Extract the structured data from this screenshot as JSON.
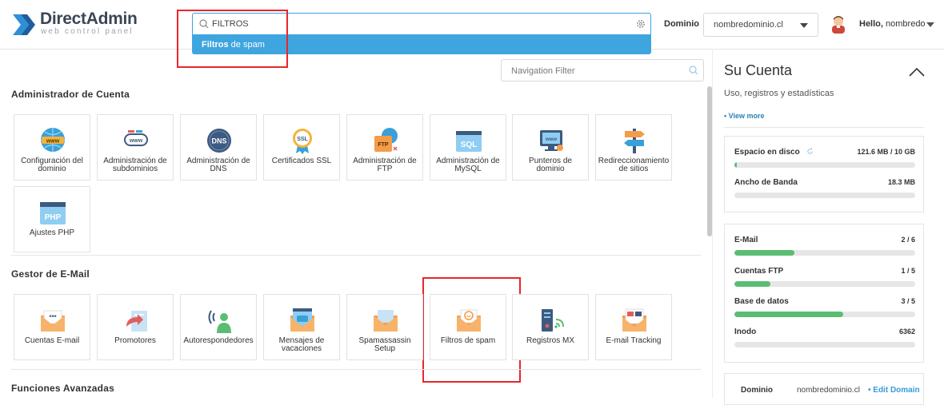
{
  "header": {
    "logo_title": "DirectAdmin",
    "logo_subtitle": "web control panel",
    "search_value": "FILTROS",
    "suggestion_bold": "Filtros",
    "suggestion_rest": " de spam",
    "domain_label": "Dominio",
    "domain_selected": "nombredominio.cl",
    "hello_prefix": "Hello, ",
    "username": "nombredo"
  },
  "main": {
    "nav_filter_placeholder": "Navigation Filter",
    "sections": [
      {
        "title": "Administrador de Cuenta",
        "tiles": [
          {
            "label": "Configuración del dominio",
            "icon": "globe-www-icon"
          },
          {
            "label": "Administración de subdominios",
            "icon": "subdomain-www-icon"
          },
          {
            "label": "Administración de DNS",
            "icon": "dns-globe-icon"
          },
          {
            "label": "Certificados SSL",
            "icon": "ssl-badge-icon"
          },
          {
            "label": "Administración de FTP",
            "icon": "ftp-folder-icon"
          },
          {
            "label": "Administración de MySQL",
            "icon": "sql-database-icon"
          },
          {
            "label": "Punteros de dominio",
            "icon": "monitor-pointer-icon"
          },
          {
            "label": "Redireccionamiento de sitios",
            "icon": "signpost-icon"
          },
          {
            "label": "Ajustes PHP",
            "icon": "php-window-icon"
          }
        ]
      },
      {
        "title": "Gestor de E-Mail",
        "tiles": [
          {
            "label": "Cuentas E-mail",
            "icon": "envelope-icon"
          },
          {
            "label": "Promotores",
            "icon": "forward-arrow-icon"
          },
          {
            "label": "Autorespondedores",
            "icon": "autoresponder-person-icon"
          },
          {
            "label": "Mensajes de vacaciones",
            "icon": "vacation-message-icon"
          },
          {
            "label": "Spamassassin Setup",
            "icon": "spamassassin-envelope-icon"
          },
          {
            "label": "Filtros de spam",
            "icon": "spam-filter-envelope-icon"
          },
          {
            "label": "Registros MX",
            "icon": "mx-server-icon"
          },
          {
            "label": "E-mail Tracking",
            "icon": "email-tracking-icon"
          }
        ]
      },
      {
        "title": "Funciones Avanzadas",
        "tiles": []
      }
    ]
  },
  "sidebar": {
    "title": "Su Cuenta",
    "subtitle": "Uso, registros y estadísticas",
    "view_more": "• View more",
    "usage": [
      {
        "name": "Espacio en disco",
        "value": "121.6 MB / 10 GB",
        "fraction": 0.012
      },
      {
        "name": "Ancho de Banda",
        "value": "18.3 MB",
        "fraction": 0.0
      }
    ],
    "resources": [
      {
        "name": "E-Mail",
        "value": "2 / 6",
        "fraction": 0.333
      },
      {
        "name": "Cuentas FTP",
        "value": "1 / 5",
        "fraction": 0.2
      },
      {
        "name": "Base de datos",
        "value": "3 / 5",
        "fraction": 0.6
      },
      {
        "name": "Inodo",
        "value": "6362",
        "fraction": 0.0
      }
    ],
    "domain_key": "Dominio",
    "domain_value": "nombredominio.cl",
    "edit_domain": "• Edit Domain"
  },
  "colors": {
    "accent": "#3fa5df",
    "highlight_border": "#e8262a",
    "progress": "#5bbd72",
    "link": "#2c7fb8"
  }
}
